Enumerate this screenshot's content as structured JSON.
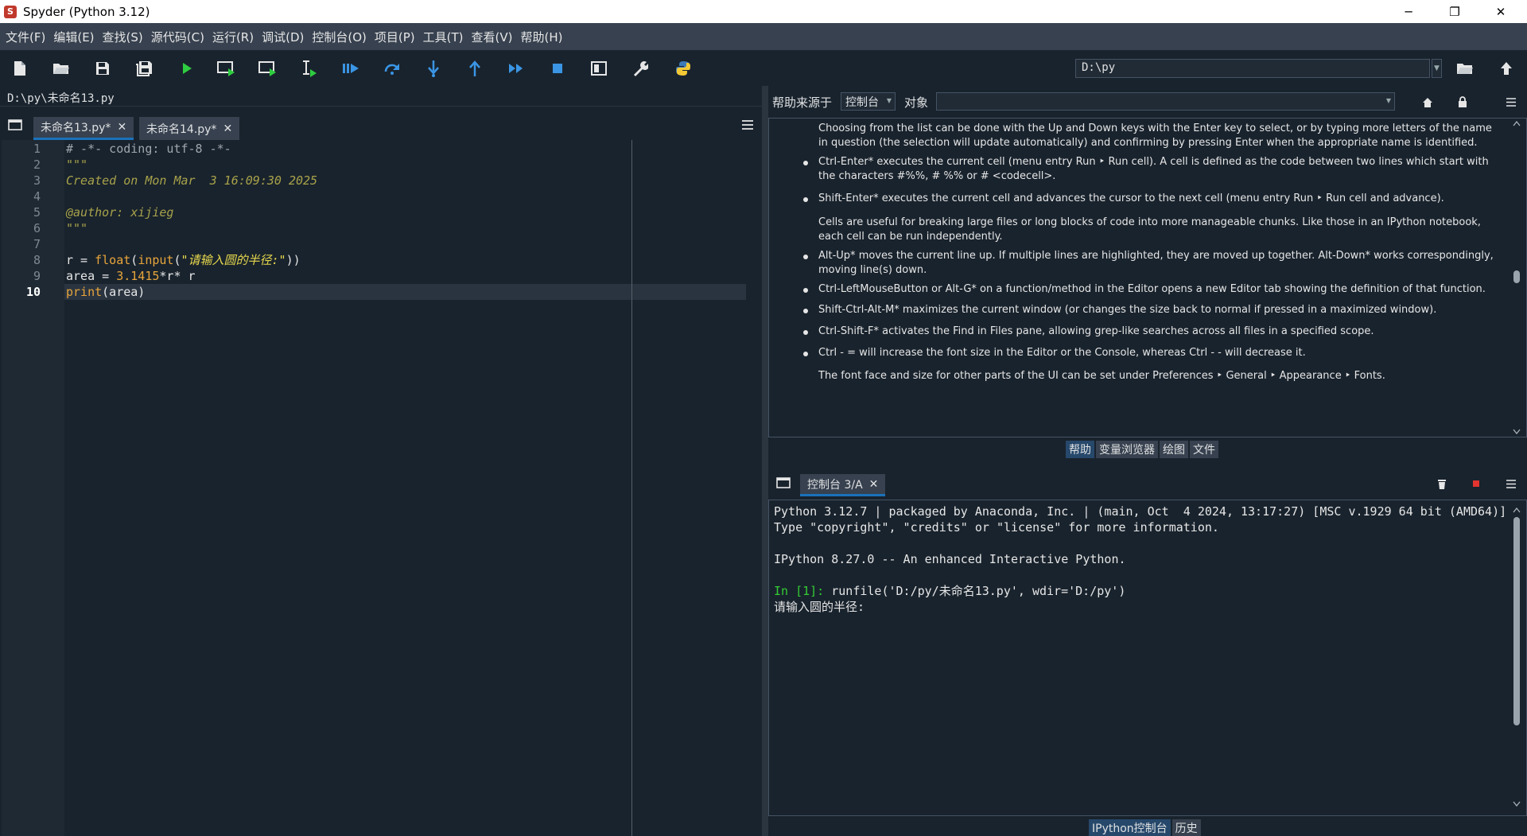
{
  "window": {
    "title": "Spyder (Python 3.12)",
    "minimize": "─",
    "maximize": "❐",
    "close": "✕"
  },
  "menu": [
    "文件(F)",
    "编辑(E)",
    "查找(S)",
    "源代码(C)",
    "运行(R)",
    "调试(D)",
    "控制台(O)",
    "项目(P)",
    "工具(T)",
    "查看(V)",
    "帮助(H)"
  ],
  "toolbar": {
    "path": "D:\\py"
  },
  "editor": {
    "filepath": "D:\\py\\未命名13.py",
    "tabs": [
      {
        "label": "未命名13.py*",
        "close": "✕"
      },
      {
        "label": "未命名14.py*",
        "close": "✕"
      }
    ],
    "line_numbers": [
      "1",
      "2",
      "3",
      "4",
      "5",
      "6",
      "7",
      "8",
      "9",
      "10"
    ],
    "lines": [
      "# -*- coding: utf-8 -*-",
      "\"\"\"",
      "Created on Mon Mar  3 16:09:30 2025",
      "",
      "@author: xijieg",
      "\"\"\"",
      "",
      "r = float(input(\"请输入圆的半径:\"))",
      "area = 3.1415*r* r",
      "print(area)"
    ],
    "current_line": 10
  },
  "help": {
    "source_label": "帮助来源于",
    "source_value": "控制台",
    "object_label": "对象",
    "object_value": "",
    "items": [
      {
        "text": "Choosing from the list can be done with the Up and Down keys with the Enter key to select, or by typing more letters of the name in question (the selection will update automatically) and confirming by pressing Enter when the appropriate name is identified.",
        "bullet": false
      },
      {
        "text": "Ctrl-Enter* executes the current cell (menu entry Run ‣ Run cell). A cell is defined as the code between two lines which start with the characters #%%, # %% or # <codecell>.",
        "bullet": true
      },
      {
        "text": "Shift-Enter* executes the current cell and advances the cursor to the next cell (menu entry Run ‣ Run cell and advance).",
        "bullet": true
      },
      {
        "text": "Cells are useful for breaking large files or long blocks of code into more manageable chunks. Like those in an IPython notebook, each cell can be run independently.",
        "bullet": false
      },
      {
        "text": "Alt-Up* moves the current line up. If multiple lines are highlighted, they are moved up together. Alt-Down* works correspondingly, moving line(s) down.",
        "bullet": true
      },
      {
        "text": "Ctrl-LeftMouseButton or Alt-G* on a function/method in the Editor opens a new Editor tab showing the definition of that function.",
        "bullet": true
      },
      {
        "text": "Shift-Ctrl-Alt-M* maximizes the current window (or changes the size back to normal if pressed in a maximized window).",
        "bullet": true
      },
      {
        "text": "Ctrl-Shift-F* activates the Find in Files pane, allowing grep-like searches across all files in a specified scope.",
        "bullet": true
      },
      {
        "text": "Ctrl - = will increase the font size in the Editor or the Console, whereas Ctrl - - will decrease it.",
        "bullet": true
      },
      {
        "text": "The font face and size for other parts of the UI can be set under Preferences ‣ General ‣ Appearance ‣ Fonts.",
        "bullet": false
      }
    ],
    "pane_tabs": [
      "帮助",
      "变量浏览器",
      "绘图",
      "文件"
    ]
  },
  "console": {
    "tab_label": "控制台 3/A",
    "tab_close": "✕",
    "lines": [
      "Python 3.12.7 | packaged by Anaconda, Inc. | (main, Oct  4 2024, 13:17:27) [MSC v.1929 64 bit (AMD64)]",
      "Type \"copyright\", \"credits\" or \"license\" for more information.",
      "",
      "IPython 8.27.0 -- An enhanced Interactive Python.",
      ""
    ],
    "prompt": "In [1]:",
    "command": " runfile('D:/py/未命名13.py', wdir='D:/py')",
    "output": "请输入圆的半径:",
    "pane_tabs": [
      "IPython控制台",
      "历史"
    ]
  },
  "colors": {
    "bg": "#19232d",
    "comment": "#9fa6ad",
    "docstring": "#a8a24a",
    "builtin": "#e8a53b",
    "string": "#e6d74d",
    "number": "#e8a53b",
    "prompt": "#33cc33",
    "accent": "#1a72bb"
  }
}
